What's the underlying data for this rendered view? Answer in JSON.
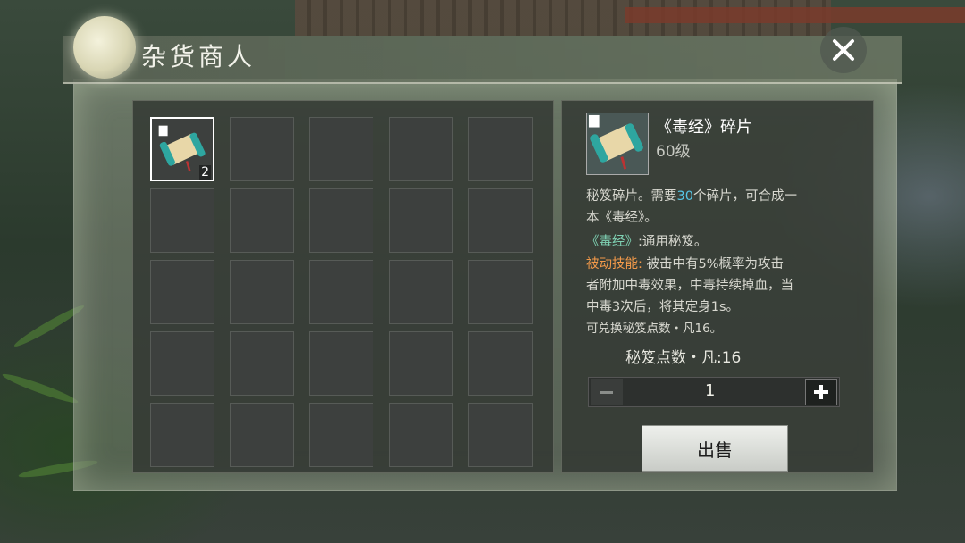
{
  "window": {
    "title": "杂货商人"
  },
  "inventory": {
    "selected_item_count": "2"
  },
  "detail": {
    "item_name": "《毒经》碎片",
    "level": "60级",
    "desc1_a": "秘笈碎片。需要",
    "desc1_b": "30",
    "desc1_c": "个碎片，可合成一",
    "desc2": "本《毒经》。",
    "desc3_a": "《毒经》",
    "desc3_b": ":通用秘笈。",
    "desc4_a": "被动技能:",
    "desc4_b": " 被击中有5%概率为攻击",
    "desc5": "者附加中毒效果，中毒持续掉血，当",
    "desc6": "中毒3次后，将其定身1s。",
    "desc7": "可兑换秘笈点数・凡16。",
    "points_label": "秘笈点数・凡:",
    "points_value": "16"
  },
  "quantity": {
    "value": "1",
    "minus": "−",
    "plus": "+"
  },
  "actions": {
    "sell_label": "出售"
  },
  "colors": {
    "highlight_number": "#56c6e6",
    "book_name": "#7fd1b3",
    "skill_label": "#f39a4a"
  }
}
